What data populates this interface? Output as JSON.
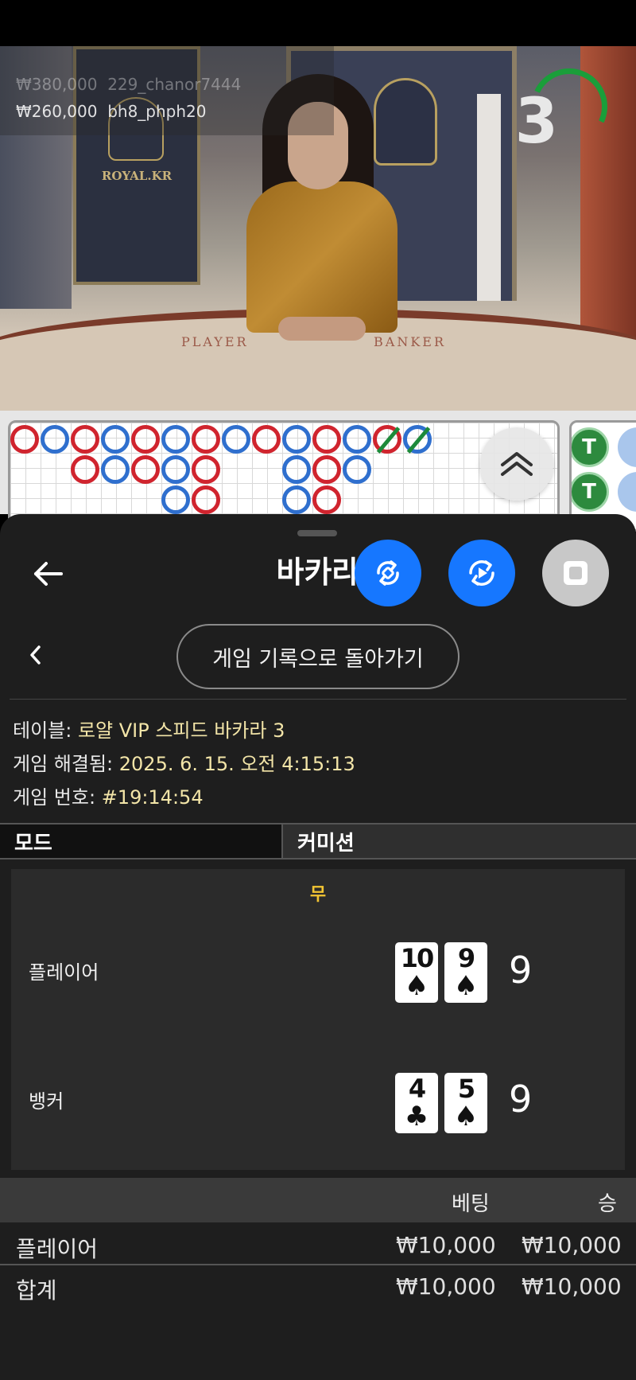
{
  "video": {
    "brand": "ROYAL.KR",
    "felt_player": "PLAYER",
    "felt_banker": "BANKER",
    "recent_bets": [
      {
        "amount": "₩380,000",
        "user": "229_chanor7444"
      },
      {
        "amount": "₩260,000",
        "user": "bh8_phph20"
      }
    ],
    "countdown": "3"
  },
  "road": {
    "tie_label": "T"
  },
  "sheet": {
    "title": "바카라",
    "history_button": "게임 기록으로 돌아가기",
    "table_label": "테이블:",
    "table_value": "로얄 VIP 스피드 바카라 3",
    "resolved_label": "게임 해결됨:",
    "resolved_value": "2025. 6. 15. 오전 4:15:13",
    "game_no_label": "게임 번호:",
    "game_no_value": "#19:14:54",
    "tabs": {
      "mode": "모드",
      "commission": "커미션"
    },
    "result": "무",
    "player": {
      "name": "플레이어",
      "cards": [
        {
          "rank": "10",
          "suit": "♠"
        },
        {
          "rank": "9",
          "suit": "♠"
        }
      ],
      "score": "9"
    },
    "banker": {
      "name": "뱅커",
      "cards": [
        {
          "rank": "4",
          "suit": "♣"
        },
        {
          "rank": "5",
          "suit": "♠"
        }
      ],
      "score": "9"
    },
    "bets_header": {
      "bet": "베팅",
      "win": "승"
    },
    "bets": [
      {
        "name": "플레이어",
        "bet": "₩10,000",
        "win": "₩10,000"
      },
      {
        "name": "합계",
        "bet": "₩10,000",
        "win": "₩10,000"
      }
    ]
  },
  "colors": {
    "accent_blue": "#1677ff",
    "player_blue": "#2f6fce",
    "banker_red": "#d0242e",
    "tie_green": "#2d8a3e",
    "value_yellow": "#f3e5a8",
    "result_yellow": "#f3c533"
  }
}
